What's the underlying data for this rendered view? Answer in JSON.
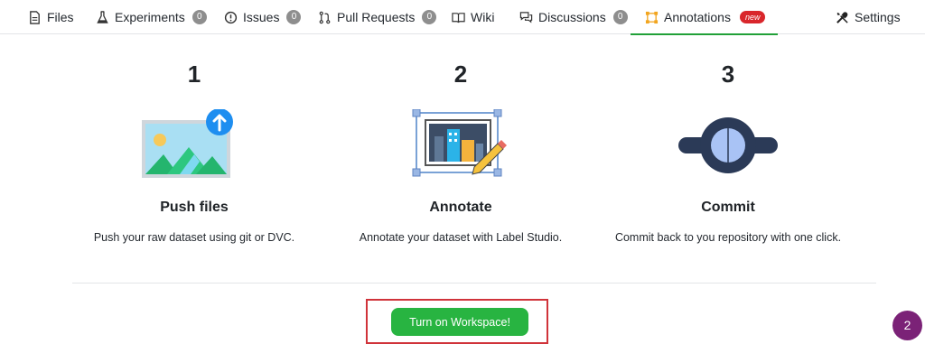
{
  "tabs": [
    {
      "label": "Files",
      "icon": "file-icon"
    },
    {
      "label": "Experiments",
      "icon": "flask-icon",
      "count": "0"
    },
    {
      "label": "Issues",
      "icon": "alert-circle-icon",
      "count": "0"
    },
    {
      "label": "Pull Requests",
      "icon": "git-pull-request-icon",
      "count": "0"
    },
    {
      "label": "Wiki",
      "icon": "book-icon"
    },
    {
      "label": "Discussions",
      "icon": "comments-icon",
      "count": "0"
    },
    {
      "label": "Annotations",
      "icon": "annotation-frame-icon",
      "badge": "new",
      "active": true
    },
    {
      "label": "Settings",
      "icon": "tools-icon"
    }
  ],
  "steps": [
    {
      "number": "1",
      "title": "Push files",
      "description": "Push your raw dataset using git or DVC.",
      "illustration": "image-upload-icon"
    },
    {
      "number": "2",
      "title": "Annotate",
      "description": "Annotate your dataset with Label Studio.",
      "illustration": "annotate-picture-icon"
    },
    {
      "number": "3",
      "title": "Commit",
      "description": "Commit back to you repository with one click.",
      "illustration": "commit-node-icon"
    }
  ],
  "cta_label": "Turn on Workspace!",
  "notification_count": "2",
  "colors": {
    "accent_green": "#28b441",
    "highlight_red": "#d0333a",
    "badge_purple": "#7b2277",
    "new_badge_red": "#d9262b"
  }
}
